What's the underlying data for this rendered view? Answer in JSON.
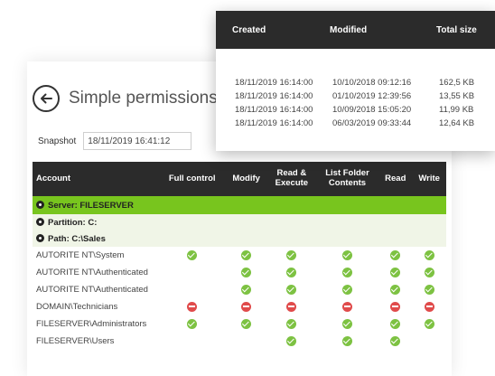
{
  "page": {
    "title": "Simple permissions",
    "snapshot_label": "Snapshot",
    "snapshot_value": "18/11/2019 16:41:12"
  },
  "table": {
    "headers": {
      "account": "Account",
      "full_control": "Full control",
      "modify": "Modify",
      "read_execute_1": "Read &",
      "read_execute_2": "Execute",
      "list_folder_1": "List Folder",
      "list_folder_2": "Contents",
      "read": "Read",
      "write": "Write"
    },
    "groups": {
      "server": "Server: FILESERVER",
      "partition": "Partition: C:",
      "path": "Path: C:\\Sales"
    },
    "rows": [
      {
        "account": "AUTORITE NT\\System"
      },
      {
        "account": "AUTORITE NT\\Authenticated"
      },
      {
        "account": "AUTORITE NT\\Authenticated"
      },
      {
        "account": "DOMAIN\\Technicians"
      },
      {
        "account": "FILESERVER\\Administrators"
      },
      {
        "account": "FILESERVER\\Users"
      }
    ],
    "permission_matrix": [
      [
        "allow",
        "allow",
        "allow",
        "allow",
        "allow",
        "allow"
      ],
      [
        "",
        "allow",
        "allow",
        "allow",
        "allow",
        "allow"
      ],
      [
        "",
        "allow",
        "allow",
        "allow",
        "allow",
        "allow"
      ],
      [
        "deny",
        "deny",
        "deny",
        "deny",
        "deny",
        "deny"
      ],
      [
        "allow",
        "allow",
        "allow",
        "allow",
        "allow",
        "allow"
      ],
      [
        "",
        "",
        "allow",
        "allow",
        "allow",
        ""
      ]
    ]
  },
  "overlay": {
    "headers": {
      "created": "Created",
      "modified": "Modified",
      "total_size": "Total size"
    },
    "rows": [
      {
        "created": "18/11/2019 16:14:00",
        "modified": "10/10/2018 09:12:16",
        "size": "162,5 KB"
      },
      {
        "created": "18/11/2019 16:14:00",
        "modified": "01/10/2019 12:39:56",
        "size": "13,55 KB"
      },
      {
        "created": "18/11/2019 16:14:00",
        "modified": "10/09/2018 15:05:20",
        "size": "11,99 KB"
      },
      {
        "created": "18/11/2019 16:14:00",
        "modified": "06/03/2019 09:33:44",
        "size": "12,64 KB"
      }
    ]
  },
  "colors": {
    "header_bg": "#2b2b2b",
    "server_row": "#78c51e",
    "sub_row": "#f0f5e7",
    "allow": "#7dc242",
    "deny": "#e04b4b"
  }
}
